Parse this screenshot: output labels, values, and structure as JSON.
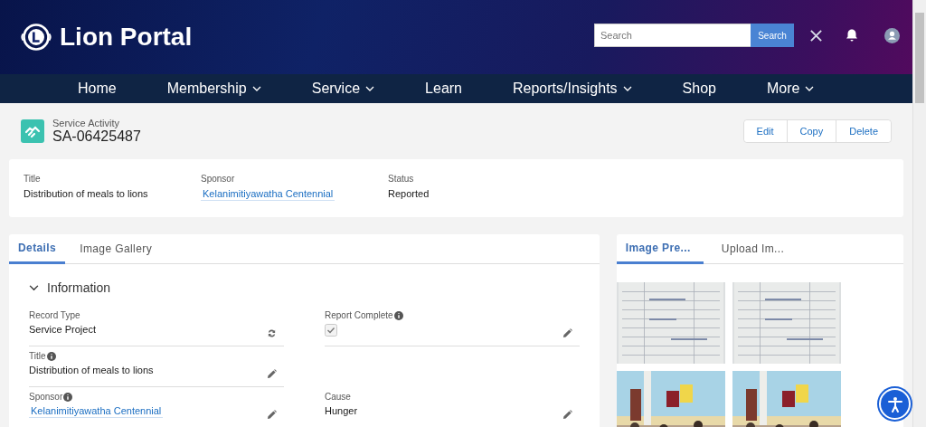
{
  "header": {
    "title": "Lion Portal",
    "search": {
      "placeholder": "Search",
      "button": "Search"
    }
  },
  "nav": [
    {
      "label": "Home",
      "dropdown": false
    },
    {
      "label": "Membership",
      "dropdown": true
    },
    {
      "label": "Service",
      "dropdown": true
    },
    {
      "label": "Learn",
      "dropdown": false
    },
    {
      "label": "Reports/Insights",
      "dropdown": true
    },
    {
      "label": "Shop",
      "dropdown": false
    },
    {
      "label": "More",
      "dropdown": true
    }
  ],
  "record": {
    "type": "Service Activity",
    "id": "SA-06425487",
    "actions": [
      "Edit",
      "Copy",
      "Delete"
    ]
  },
  "highlights": [
    {
      "label": "Title",
      "value": "Distribution of meals to lions",
      "kind": "text"
    },
    {
      "label": "Sponsor",
      "value": "Kelanimitiyawatha Centennial",
      "kind": "link"
    },
    {
      "label": "Status",
      "value": "Reported",
      "kind": "text"
    }
  ],
  "detail_tabs": [
    {
      "label": "Details",
      "selected": true
    },
    {
      "label": "Image Gallery",
      "selected": false
    }
  ],
  "section": {
    "title": "Information",
    "expanded": true,
    "rows": [
      {
        "left": {
          "label": "Record Type",
          "info": false,
          "kind": "text",
          "value": "Service Project",
          "button": {
            "kind": "swap"
          }
        },
        "right": {
          "label": "Report Complete",
          "info": true,
          "kind": "checkbox",
          "checked": true,
          "button": {
            "kind": "edit"
          }
        }
      },
      {
        "left": {
          "label": "Title",
          "info": true,
          "kind": "text",
          "value": "Distribution of meals to lions",
          "button": {
            "kind": "edit"
          }
        }
      },
      {
        "left": {
          "label": "Sponsor",
          "info": true,
          "kind": "link",
          "value": "Kelanimitiyawatha Centennial",
          "button": {
            "kind": "edit"
          }
        },
        "right": {
          "label": "Cause",
          "info": false,
          "kind": "text",
          "value": "Hunger",
          "button": {
            "kind": "edit"
          }
        }
      }
    ]
  },
  "preview_tabs": [
    {
      "label": "Image Pre...",
      "selected": true
    },
    {
      "label": "Upload Im...",
      "selected": false
    }
  ]
}
